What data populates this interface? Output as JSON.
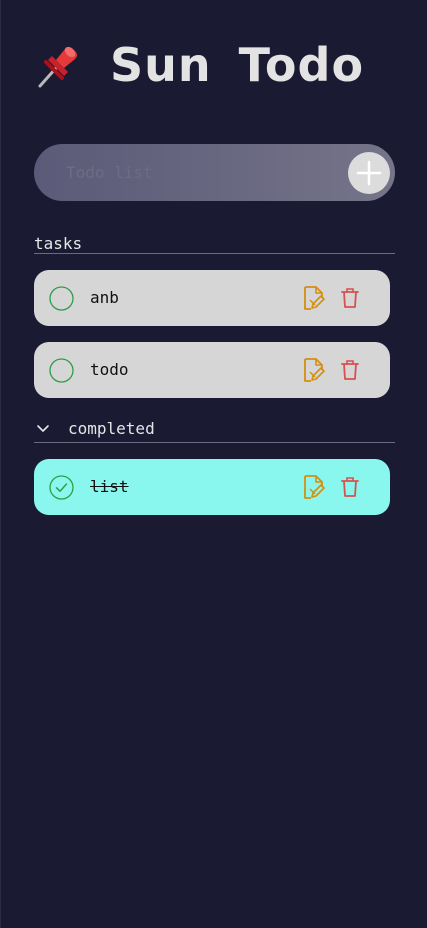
{
  "app": {
    "title": "Sun Todo",
    "logo_icon": "pushpin-icon"
  },
  "input": {
    "value": "",
    "placeholder": "Todo list",
    "add_icon": "plus-icon"
  },
  "sections": {
    "tasks": {
      "title": "tasks",
      "items": [
        {
          "label": "anb",
          "completed": false
        },
        {
          "label": "todo",
          "completed": false
        }
      ]
    },
    "completed": {
      "title": "completed",
      "expanded": true,
      "toggle_icon": "chevron-down-icon",
      "items": [
        {
          "label": "list",
          "completed": true
        }
      ]
    }
  },
  "colors": {
    "background": "#1a1a33",
    "task_card": "#d6d6d6",
    "completed_card": "#8af7ee",
    "check": "#2e9e4a",
    "edit": "#d38f12",
    "delete": "#d5524f"
  }
}
